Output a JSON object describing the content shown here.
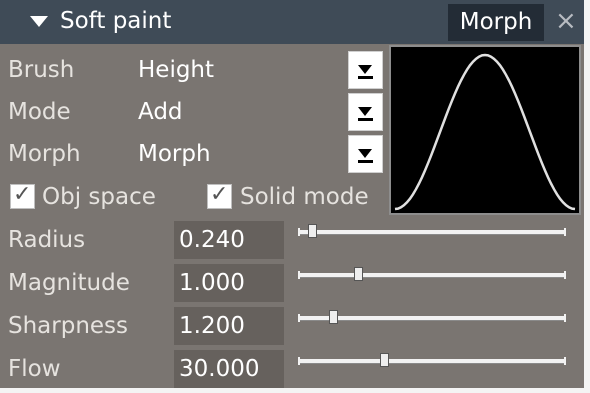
{
  "titlebar": {
    "arrow_icon": "triangle-down-icon",
    "title": "Soft paint",
    "tab_label": "Morph",
    "close_icon": "close-icon",
    "close_glyph": "×"
  },
  "dropdowns": [
    {
      "label": "Brush",
      "value": "Height"
    },
    {
      "label": "Mode",
      "value": "Add"
    },
    {
      "label": "Morph",
      "value": "Morph"
    }
  ],
  "checkboxes": [
    {
      "label": "Obj space",
      "checked": true
    },
    {
      "label": "Solid mode",
      "checked": true
    }
  ],
  "sliders": [
    {
      "label": "Radius",
      "value": "0.240",
      "position": 0.03
    },
    {
      "label": "Magnitude",
      "value": "1.000",
      "position": 0.2
    },
    {
      "label": "Sharpness",
      "value": "1.200",
      "position": 0.11
    },
    {
      "label": "Flow",
      "value": "30.000",
      "position": 0.3
    }
  ],
  "colors": {
    "panel": "#7a7571",
    "titlebar": "#3f4b57",
    "tab": "#232c36",
    "field": "#66615d",
    "curve": "#e0e0e0"
  }
}
